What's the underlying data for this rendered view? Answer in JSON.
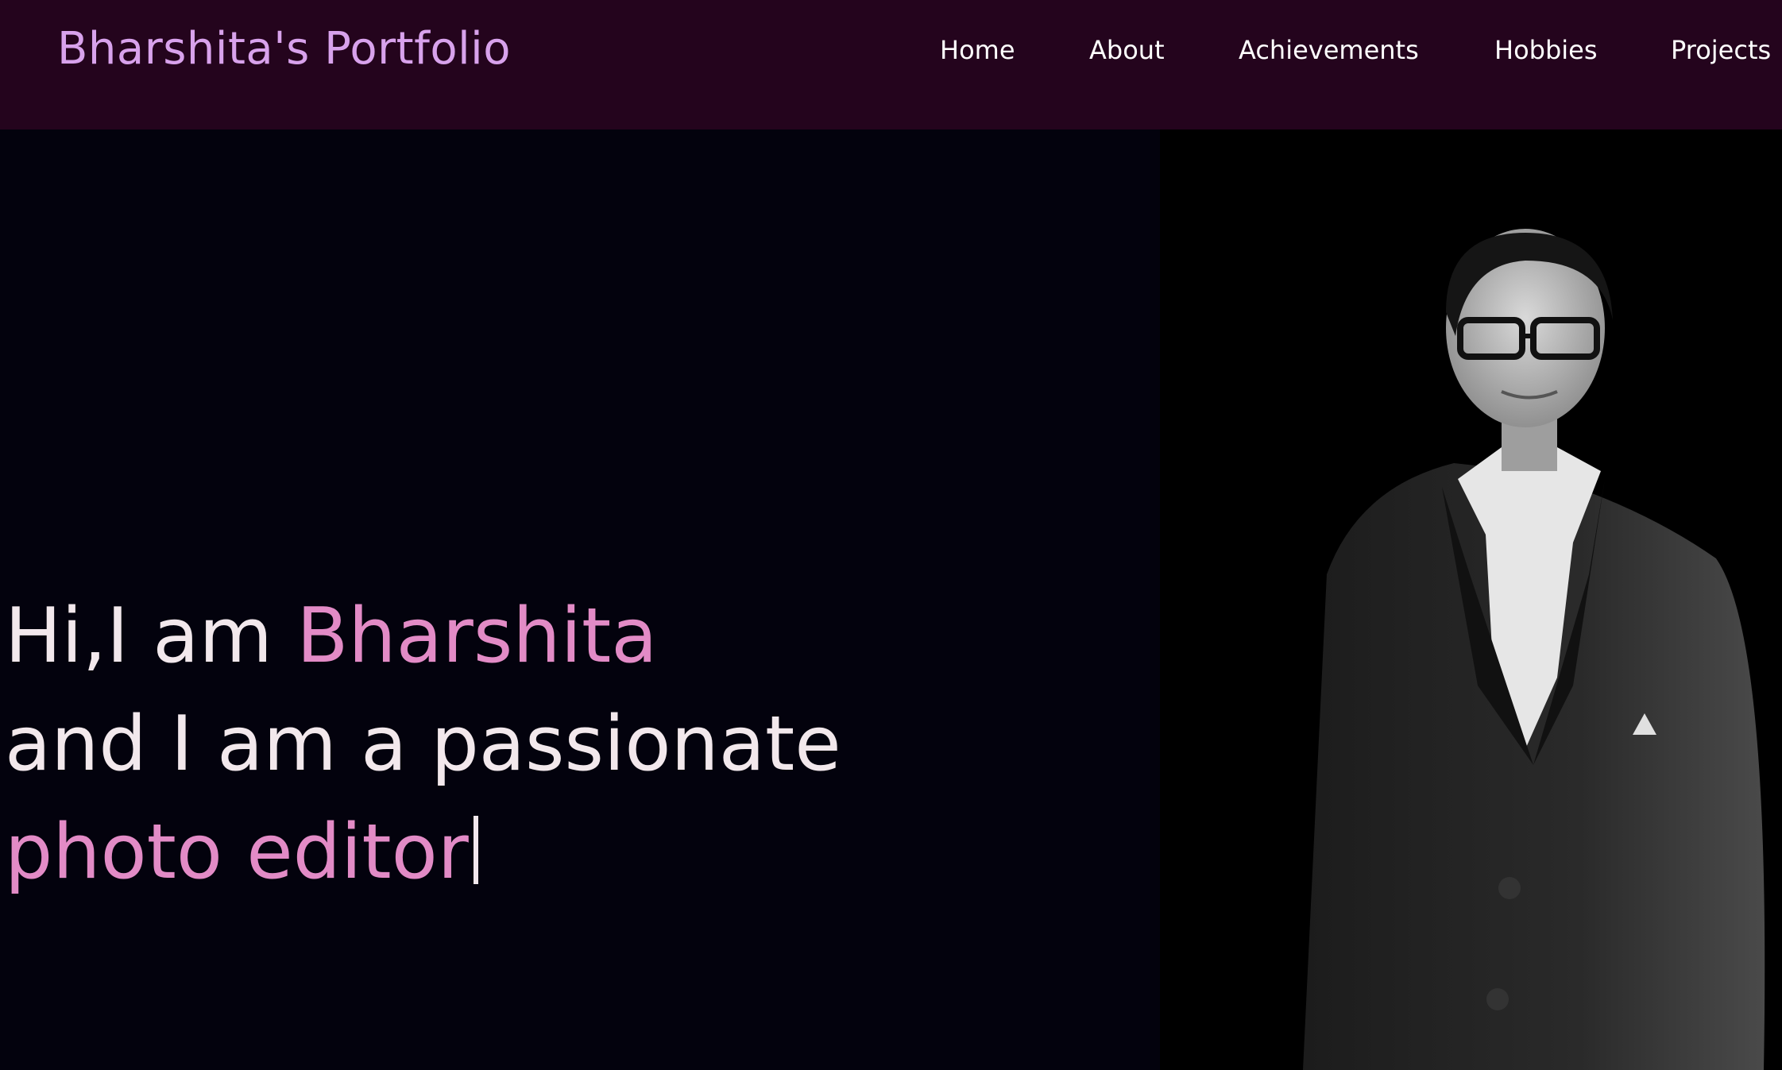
{
  "brand": {
    "title": "Bharshita's Portfolio"
  },
  "nav": {
    "items": [
      {
        "label": "Home"
      },
      {
        "label": "About"
      },
      {
        "label": "Achievements"
      },
      {
        "label": "Hobbies"
      },
      {
        "label": "Projects"
      }
    ]
  },
  "hero": {
    "greeting_prefix": "Hi,I am ",
    "name": "Bharshita",
    "line2": "and I am a passionate",
    "typed_role": "photo editor"
  },
  "photo": {
    "icon": "portrait-photo"
  },
  "colors": {
    "navbar_bg": "#24041d",
    "brand": "#d8a2ec",
    "hero_bg": "#03020d",
    "text": "#f2e8ec",
    "accent": "#e28bc6"
  }
}
